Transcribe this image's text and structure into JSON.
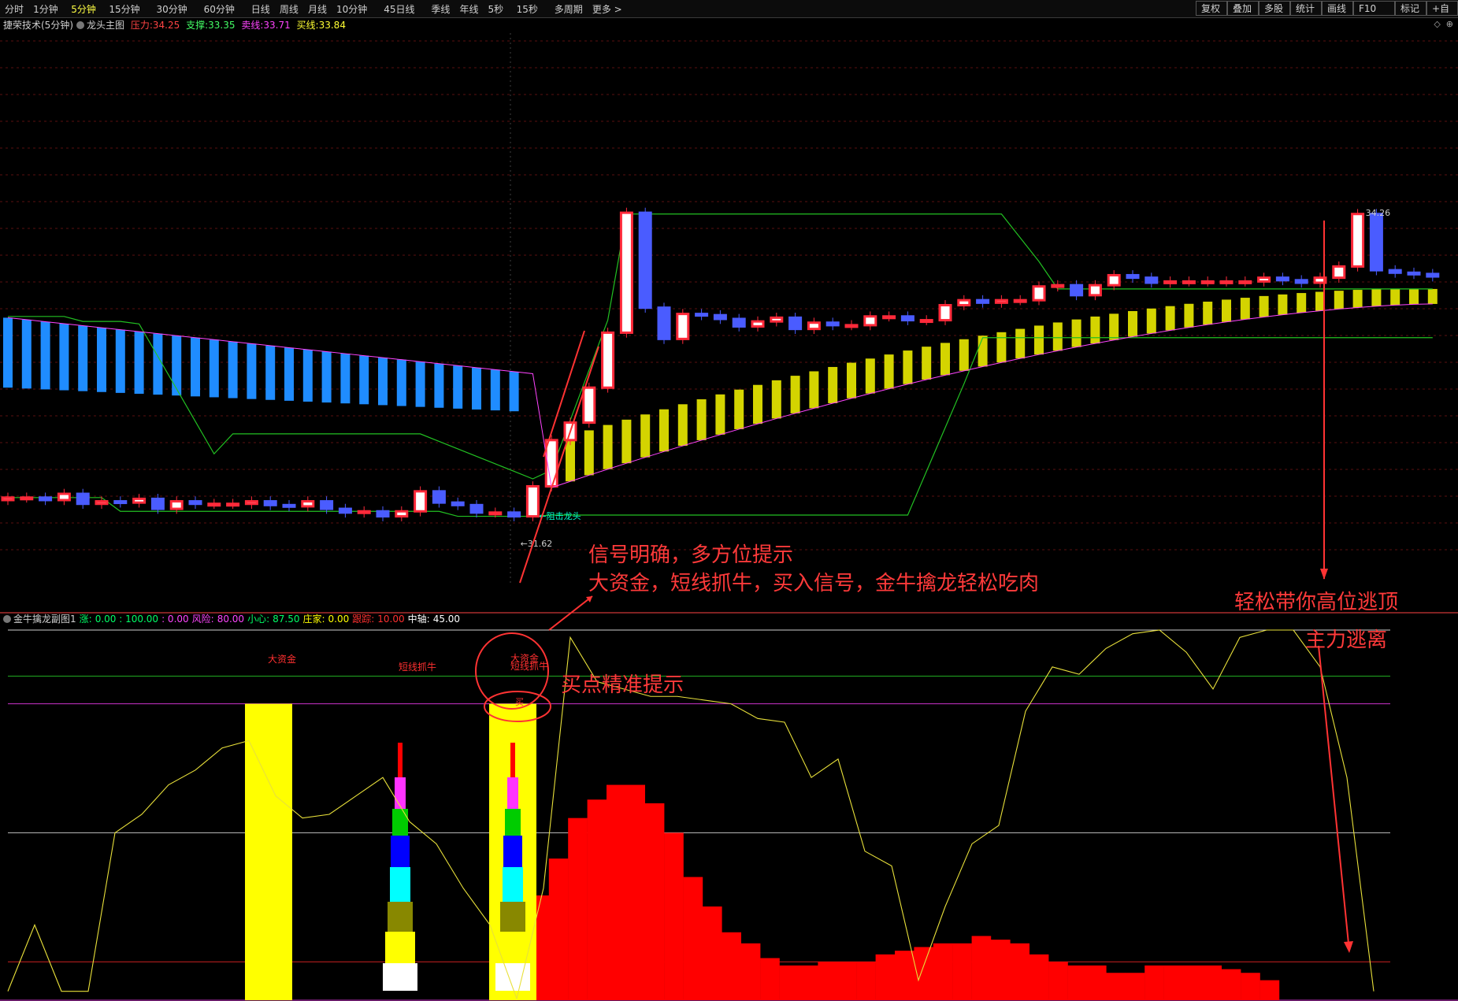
{
  "toolbar": {
    "periods": [
      "分时",
      "1分钟",
      "5分钟",
      "15分钟",
      "30分钟",
      "60分钟",
      "日线",
      "周线",
      "月线",
      "10分钟",
      "45日线",
      "季线",
      "年线",
      "5秒",
      "15秒",
      "多周期",
      "更多 >"
    ],
    "active_period": "5分钟",
    "right_buttons": [
      "复权",
      "叠加",
      "多股",
      "统计",
      "画线",
      "F10",
      "标记",
      "+自"
    ]
  },
  "main_panel": {
    "stock_name": "捷荣技术(5分钟)",
    "indicator": "龙头主图",
    "pressure_label": "压力:",
    "pressure_value": "34.25",
    "support_label": "支撑:",
    "support_value": "33.35",
    "sell_label": "卖线:",
    "sell_value": "33.71",
    "buy_label": "买线:",
    "buy_value": "33.84",
    "tag_low": "←31.62",
    "tag_high": "34.26",
    "tag_ambush": "←阻击龙头"
  },
  "sub_panel": {
    "indicator": "金牛擒龙副图1",
    "items": [
      {
        "label": "涨:",
        "value": "0.00 : 100.00",
        "color": "#00ff66"
      },
      {
        "label": "",
        "value": ": 0.00",
        "color": "#ff44ff"
      },
      {
        "label": "风险:",
        "value": "80.00",
        "color": "#ff44ff"
      },
      {
        "label": "小心:",
        "value": "87.50",
        "color": "#00ff66"
      },
      {
        "label": "庄家:",
        "value": "0.00",
        "color": "#ffff00"
      },
      {
        "label": "跟踪:",
        "value": "10.00",
        "color": "#ff3030"
      },
      {
        "label": "中轴:",
        "value": "45.00",
        "color": "#ffffff"
      }
    ],
    "labels": {
      "dazijin": "大资金",
      "duanxian": "短线抓牛",
      "dazijin2": "大资金",
      "duanxian2": "短线抓牛",
      "buy": "买"
    }
  },
  "annotations": {
    "line1": "信号明确，多方位提示",
    "line2": "大资金，短线抓牛，买入信号，金牛擒龙轻松吃肉",
    "buy_point": "买点精准提示",
    "escape": "轻松带你高位逃顶",
    "main_escape": "主力逃离"
  },
  "colors": {
    "up_candle": "#ff2a3a",
    "down_candle": "#4a5cff",
    "ribbon_down": "#1f8cff",
    "ribbon_up": "#d4d400",
    "band_line": "#22c022",
    "osc_line": "#e8e03a",
    "red_area": "#ff0000",
    "annotation": "#ff3333"
  },
  "chart_data": {
    "type": "candlestick",
    "price_labels": {
      "low": 31.62,
      "high": 34.26,
      "pressure": 34.25,
      "support": 33.35,
      "sell": 33.71,
      "buy": 33.84
    },
    "candles_note": "price scale estimated; green band = pressure/support channel; ribbon = buy/sell line fill",
    "closes": [
      31.98,
      31.98,
      31.96,
      32.01,
      31.93,
      31.95,
      31.94,
      31.97,
      31.89,
      31.95,
      31.93,
      31.93,
      31.93,
      31.95,
      31.92,
      31.91,
      31.95,
      31.89,
      31.86,
      31.87,
      31.83,
      31.87,
      32.03,
      31.94,
      31.92,
      31.86,
      31.86,
      31.83,
      32.07,
      32.44,
      32.58,
      32.86,
      33.3,
      34.26,
      33.5,
      33.25,
      33.45,
      33.44,
      33.41,
      33.35,
      33.39,
      33.42,
      33.33,
      33.38,
      33.36,
      33.36,
      33.43,
      33.43,
      33.4,
      33.4,
      33.52,
      33.56,
      33.54,
      33.56,
      33.56,
      33.67,
      33.68,
      33.6,
      33.68,
      33.76,
      33.74,
      33.7,
      33.71,
      33.71,
      33.71,
      33.71,
      33.71,
      33.74,
      33.72,
      33.7,
      33.74,
      33.83,
      34.25,
      33.8,
      33.78,
      33.77,
      33.75
    ],
    "oscillator": {
      "levels": [
        0,
        20,
        45,
        80,
        87.5,
        100
      ],
      "values": [
        2,
        20,
        2,
        2,
        45,
        50,
        58,
        62,
        68,
        70,
        55,
        49,
        50,
        55,
        60,
        48,
        42,
        30,
        20,
        0,
        30,
        98,
        86,
        84,
        82,
        82,
        81,
        80,
        76,
        75,
        60,
        65,
        40,
        36,
        5,
        25,
        42,
        47,
        78,
        90,
        88,
        95,
        99,
        100,
        94,
        84,
        98,
        100,
        100,
        90,
        60,
        2
      ],
      "red_area": [
        14,
        28,
        38,
        49,
        54,
        58,
        58,
        53,
        45,
        33,
        25,
        18,
        15,
        11,
        9,
        9,
        10,
        10,
        10,
        12,
        13,
        14,
        15,
        15,
        17,
        16,
        15,
        12,
        10,
        9,
        9,
        7,
        7,
        9,
        9,
        9,
        9,
        8,
        7,
        5
      ],
      "signals": [
        "大资金",
        "短线抓牛",
        "大资金",
        "短线抓牛",
        "买"
      ]
    }
  }
}
